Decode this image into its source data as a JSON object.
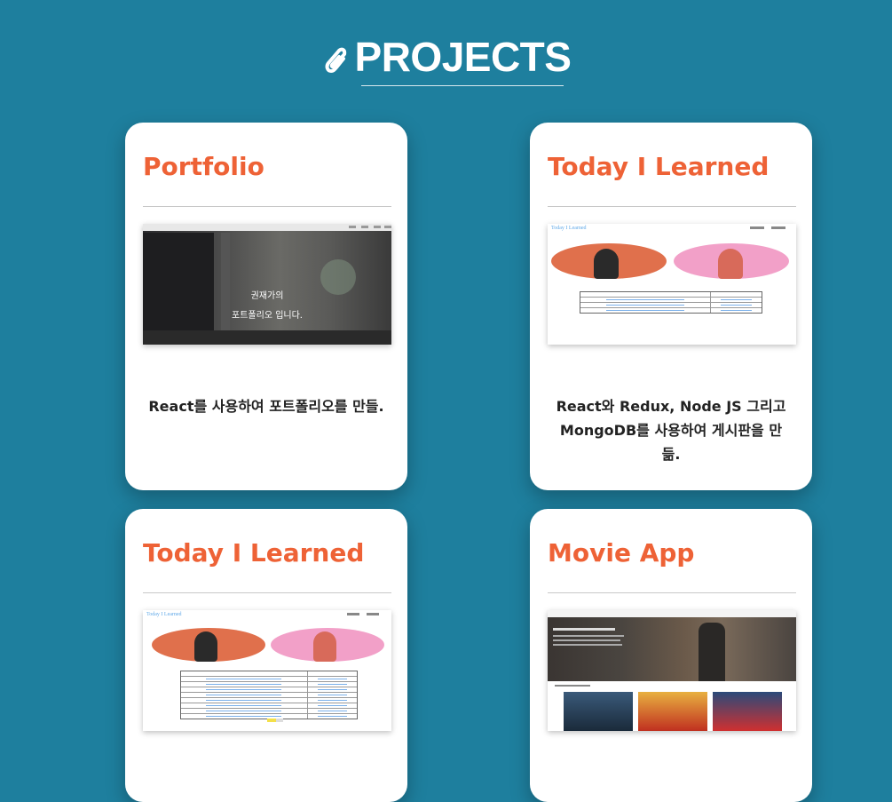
{
  "section": {
    "title": "PROJECTS",
    "icon": "paperclip-icon"
  },
  "colors": {
    "background": "#1e7f9e",
    "accent": "#ee6236",
    "card": "#ffffff"
  },
  "projects": [
    {
      "title": "Portfolio",
      "description": "React를 사용하여 포트폴리오를 만들.",
      "thumbnail": {
        "line1": "권재가의",
        "line2": "포트폴리오 입니다."
      }
    },
    {
      "title": "Today I Learned",
      "description": "React와 Redux, Node JS 그리고 MongoDB를 사용하여 게시판을 만듦."
    },
    {
      "title": "Today I Learned",
      "description": ""
    },
    {
      "title": "Movie App",
      "description": ""
    }
  ]
}
